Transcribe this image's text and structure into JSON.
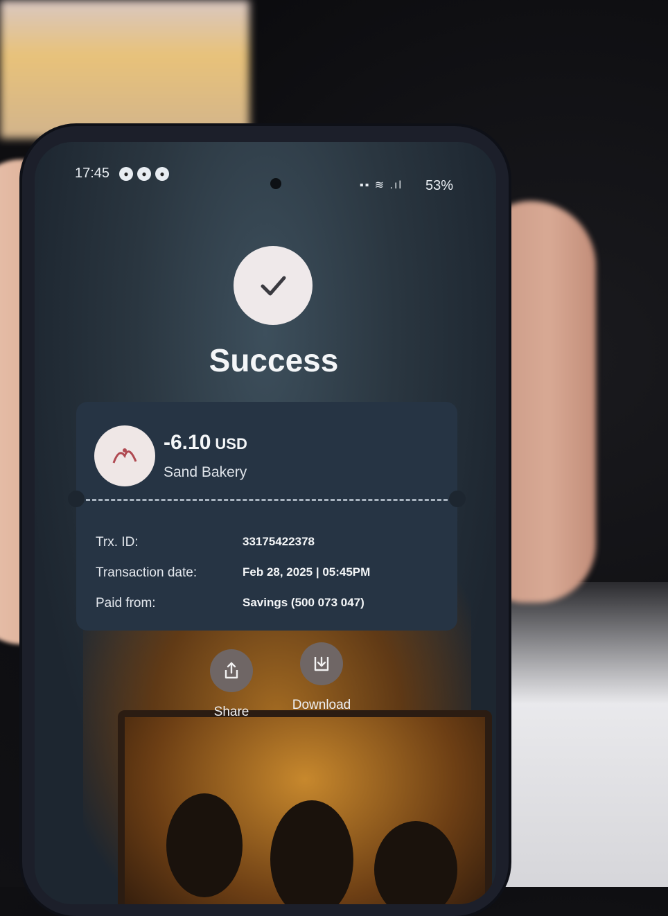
{
  "status_bar": {
    "time": "17:45",
    "battery": "53%"
  },
  "result": {
    "title": "Success",
    "icon": "checkmark-icon"
  },
  "receipt": {
    "amount": "-6.10",
    "currency": "USD",
    "merchant": "Sand Bakery",
    "rows": [
      {
        "label": "Trx. ID:",
        "value": "33175422378"
      },
      {
        "label": "Transaction date:",
        "value": "Feb 28, 2025 | 05:45PM"
      },
      {
        "label": "Paid from:",
        "value": "Savings (500 073 047)"
      }
    ]
  },
  "actions": [
    {
      "label": "Share",
      "icon": "share-icon"
    },
    {
      "label": "Download",
      "icon": "download-icon"
    }
  ],
  "colors": {
    "card_background": "#263444",
    "check_circle": "#efe9ea",
    "action_button": "#6f6665"
  }
}
